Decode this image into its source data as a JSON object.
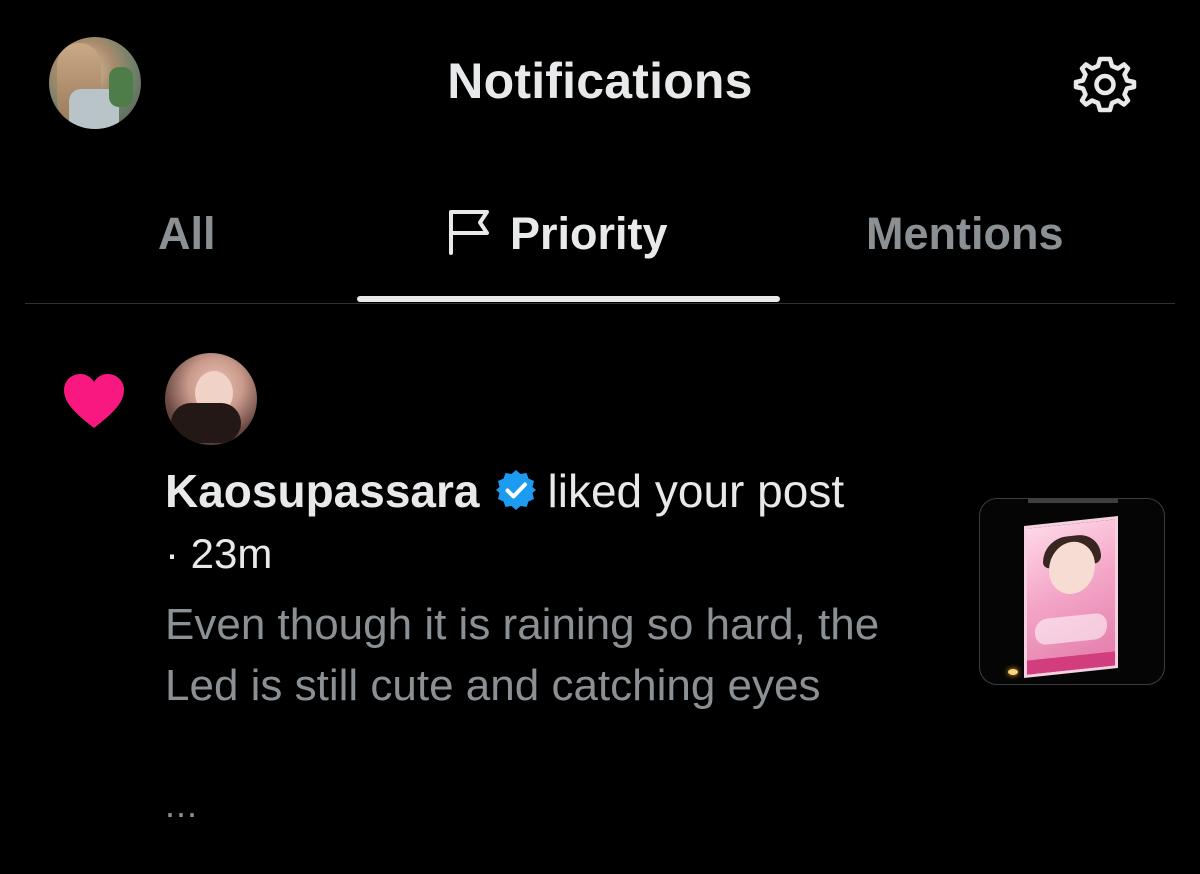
{
  "header": {
    "title": "Notifications",
    "profile_icon": "avatar",
    "settings_icon": "gear-icon"
  },
  "tabs": [
    {
      "label": "All",
      "active": false
    },
    {
      "label": "Priority",
      "active": true,
      "icon": "flag-icon"
    },
    {
      "label": "Mentions",
      "active": false
    }
  ],
  "notification": {
    "type_icon": "heart-icon",
    "username": "Kaosupassara",
    "verified": true,
    "action": "liked your post",
    "time": "· 23m",
    "post_text": "Even though it is raining so hard, the Led is still cute and catching eyes",
    "more": "..."
  },
  "colors": {
    "background": "#000000",
    "primary_text": "#e7e9ea",
    "secondary_text": "#8b9095",
    "heart": "#f91880",
    "verified": "#1d9bf0",
    "divider": "#2f3336"
  }
}
